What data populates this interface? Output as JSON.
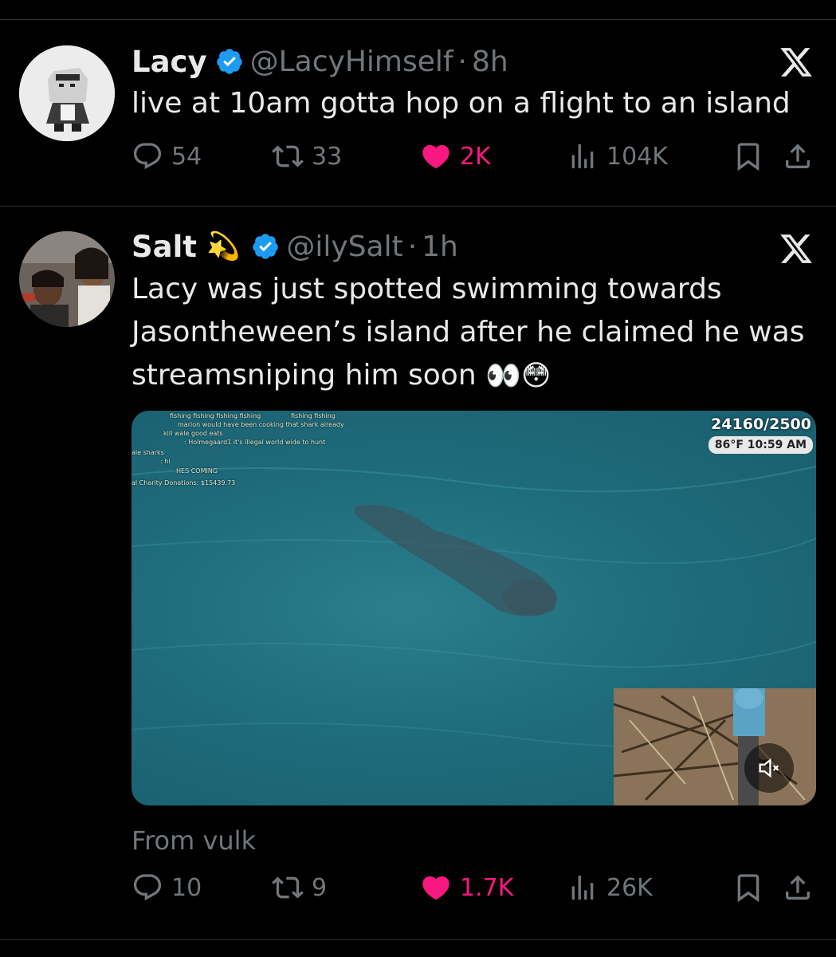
{
  "tweet1": {
    "name": "Lacy",
    "handle": "@LacyHimself",
    "time_sep": "·",
    "time": "8h",
    "text": "live at 10am gotta hop on a flight to an island",
    "replies": "54",
    "retweets": "33",
    "likes": "2K",
    "views": "104K"
  },
  "tweet2": {
    "name": "Salt",
    "name_emoji": "💫",
    "handle": "@ilySalt",
    "time_sep": "·",
    "time": "1h",
    "text": "Lacy was just spotted swimming towards Jasontheween’s island after he claimed he was streamsniping him soon ",
    "text_emoji": "👀😳",
    "media": {
      "counter": "24160/2500",
      "weather": "86°F 10:59 AM",
      "chat": [
        "fishing fishing fishing fishing",
        "fishing fishing",
        "marion would have been cooking that shark already",
        "kill wale good eats",
        ": Holmegaard1 it's illegal world wide to hunt",
        "ale sharks",
        ": hi",
        "HES COMING",
        "al Charity Donations: $15439.73"
      ]
    },
    "source": "From vulk",
    "replies": "10",
    "retweets": "9",
    "likes": "1.7K",
    "views": "26K"
  },
  "icons": {
    "verified": "verified-badge-icon",
    "x": "x-logo-icon",
    "reply": "reply-icon",
    "retweet": "retweet-icon",
    "like": "heart-icon",
    "views": "views-icon",
    "bookmark": "bookmark-icon",
    "share": "share-icon",
    "mute": "mute-icon"
  },
  "colors": {
    "background": "#000000",
    "text": "#e7e9ea",
    "muted": "#71767b",
    "like": "#f91880",
    "verified": "#1d9bf0",
    "divider": "#2f3336"
  }
}
